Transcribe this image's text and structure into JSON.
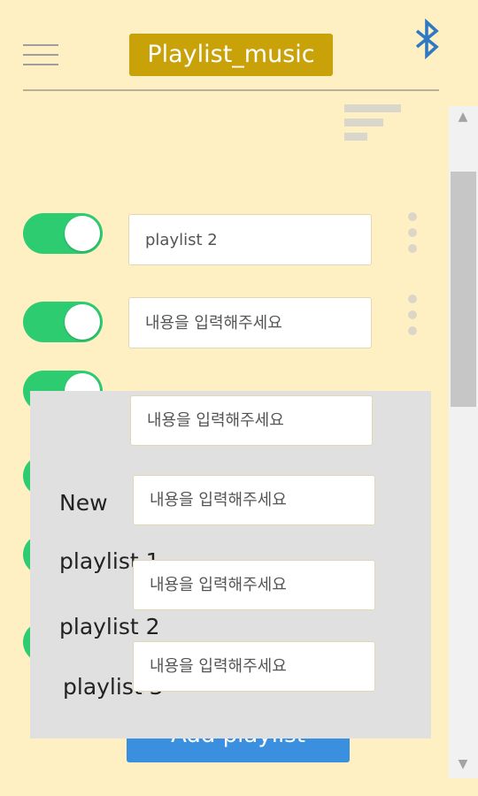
{
  "header": {
    "title": "Playlist_music"
  },
  "icons": {
    "menu": "hamburger-menu-icon",
    "bluetooth": "bluetooth-icon",
    "sort": "sort-icon",
    "more": "more-vertical-icon"
  },
  "colors": {
    "background": "#fff0c4",
    "title_badge": "#c9a20a",
    "toggle_on": "#2ecc71",
    "bluetooth": "#2f78c4",
    "add_button": "#3a8fdf",
    "overlay": "#e0e0e0"
  },
  "playlist_rows": [
    {
      "enabled": true,
      "value": "playlist 2",
      "placeholder": ""
    },
    {
      "enabled": true,
      "value": "",
      "placeholder": "내용을 입력해주세요"
    },
    {
      "enabled": true,
      "value": "",
      "placeholder": ""
    },
    {
      "enabled": true,
      "value": "",
      "placeholder": ""
    },
    {
      "enabled": true,
      "value": "",
      "placeholder": ""
    },
    {
      "enabled": true,
      "value": "",
      "placeholder": ""
    }
  ],
  "overlay": {
    "labels": [
      "New",
      "playlist 1",
      "playlist 2",
      "playlist 3"
    ],
    "inputs": [
      {
        "placeholder": "내용을 입력해주세요"
      },
      {
        "placeholder": "내용을 입력해주세요"
      },
      {
        "placeholder": "내용을 입력해주세요"
      },
      {
        "placeholder": "내용을 입력해주세요"
      }
    ]
  },
  "add_button": {
    "label": "Add playlist"
  }
}
